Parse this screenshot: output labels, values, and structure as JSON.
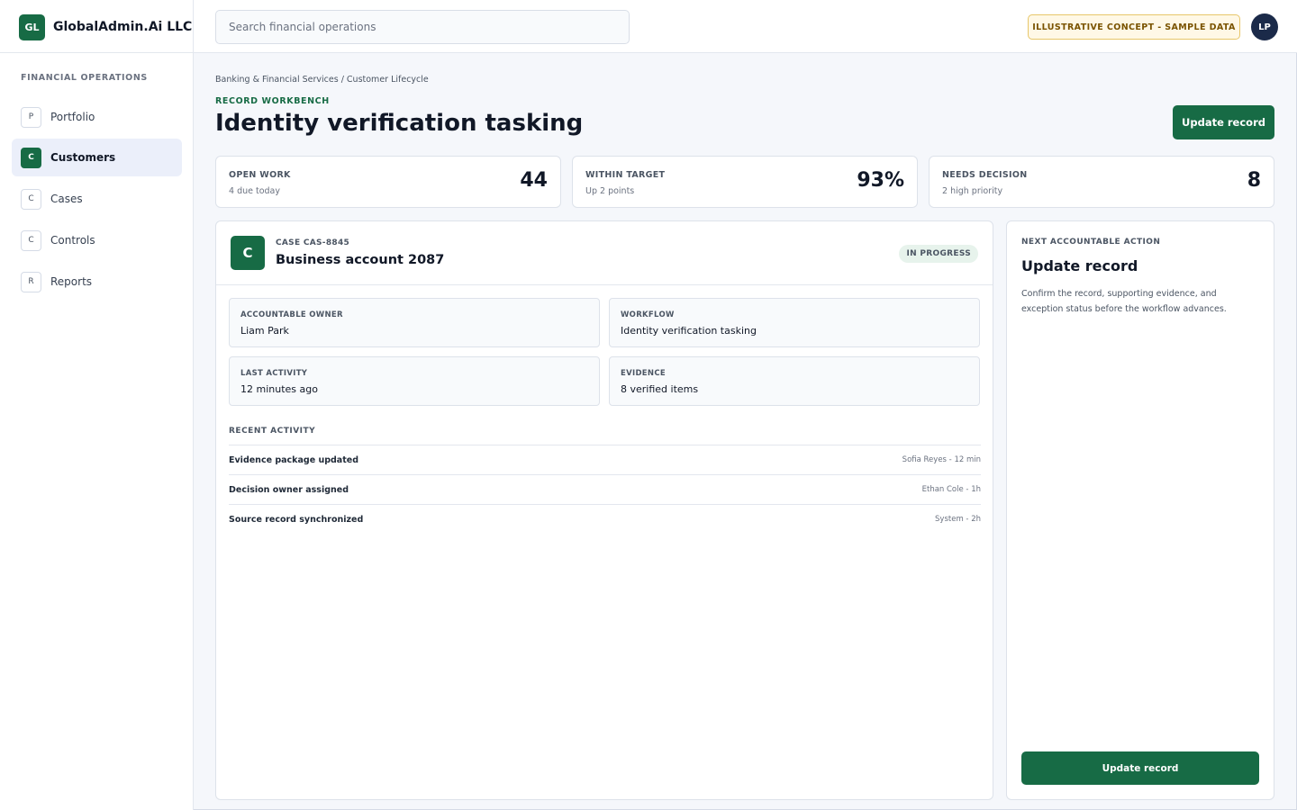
{
  "brand": {
    "mark": "GL",
    "name": "GlobalAdmin.Ai LLC"
  },
  "search": {
    "placeholder": "Search financial operations",
    "value": ""
  },
  "header": {
    "concept_badge": "ILLUSTRATIVE CONCEPT - SAMPLE DATA",
    "avatar_initials": "LP"
  },
  "sidebar": {
    "heading": "FINANCIAL OPERATIONS",
    "items": [
      {
        "letter": "P",
        "label": "Portfolio",
        "active": false
      },
      {
        "letter": "C",
        "label": "Customers",
        "active": true
      },
      {
        "letter": "C",
        "label": "Cases",
        "active": false
      },
      {
        "letter": "C",
        "label": "Controls",
        "active": false
      },
      {
        "letter": "R",
        "label": "Reports",
        "active": false
      }
    ]
  },
  "main": {
    "breadcrumb": "Banking & Financial Services / Customer Lifecycle",
    "eyebrow": "RECORD WORKBENCH",
    "title": "Identity verification tasking",
    "primary_button": "Update record"
  },
  "stats": [
    {
      "label": "OPEN WORK",
      "sub": "4 due today",
      "value": "44"
    },
    {
      "label": "WITHIN TARGET",
      "sub": "Up 2 points",
      "value": "93%"
    },
    {
      "label": "NEEDS DECISION",
      "sub": "2 high priority",
      "value": "8"
    }
  ],
  "case": {
    "mark": "C",
    "id": "CASE CAS-8845",
    "name": "Business account 2087",
    "status": "IN PROGRESS",
    "fields": [
      {
        "label": "ACCOUNTABLE OWNER",
        "value": "Liam Park"
      },
      {
        "label": "WORKFLOW",
        "value": "Identity verification tasking"
      },
      {
        "label": "LAST ACTIVITY",
        "value": "12 minutes ago"
      },
      {
        "label": "EVIDENCE",
        "value": "8 verified items"
      }
    ],
    "activity_heading": "RECENT ACTIVITY",
    "activity": [
      {
        "title": "Evidence package updated",
        "meta": "Sofia Reyes - 12 min"
      },
      {
        "title": "Decision owner assigned",
        "meta": "Ethan Cole - 1h"
      },
      {
        "title": "Source record synchronized",
        "meta": "System - 2h"
      }
    ]
  },
  "action": {
    "eyebrow": "NEXT ACCOUNTABLE ACTION",
    "title": "Update record",
    "description": "Confirm the record, supporting evidence, and exception status before the workflow advances.",
    "button": "Update record"
  },
  "colors": {
    "brand": "#176b45",
    "avatar": "#1b2a49",
    "badge_bg": "#fff8e6",
    "badge_border": "#e7c66a"
  }
}
